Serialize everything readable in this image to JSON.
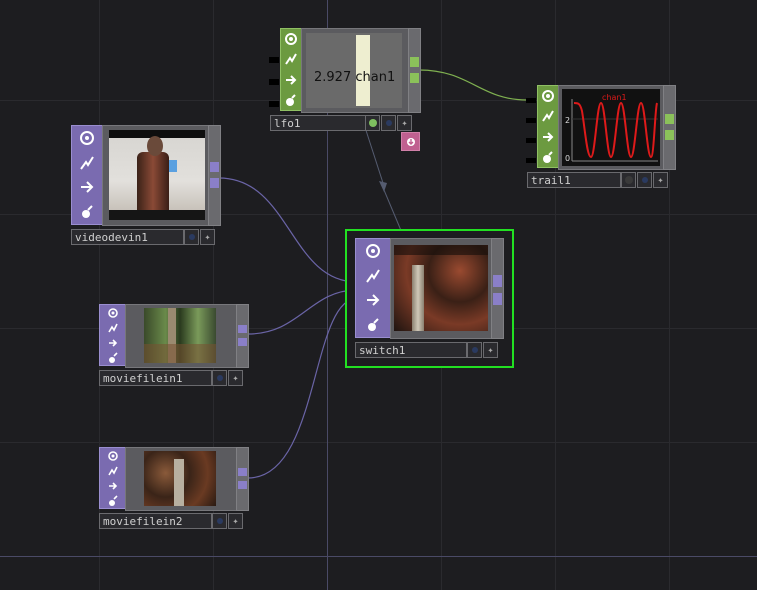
{
  "network": {
    "nodes": {
      "lfo1": {
        "name": "lfo1",
        "value": "2.927",
        "channel": "chan1",
        "type": "CHOP"
      },
      "trail1": {
        "name": "trail1",
        "type": "CHOP",
        "graph_label": "chan1",
        "y_ticks": [
          "2",
          "0"
        ]
      },
      "videodevin1": {
        "name": "videodevin1",
        "type": "TOP"
      },
      "moviefilein1": {
        "name": "moviefilein1",
        "type": "TOP"
      },
      "moviefilein2": {
        "name": "moviefilein2",
        "type": "TOP"
      },
      "switch1": {
        "name": "switch1",
        "type": "TOP",
        "selected": true
      }
    },
    "colors": {
      "background": "#1d1d20",
      "top_family": "#7a6bb0",
      "chop_family": "#6c9a40",
      "selection": "#22e022",
      "trail_line": "#dd1a1a",
      "export_flag": "#c06090"
    }
  }
}
